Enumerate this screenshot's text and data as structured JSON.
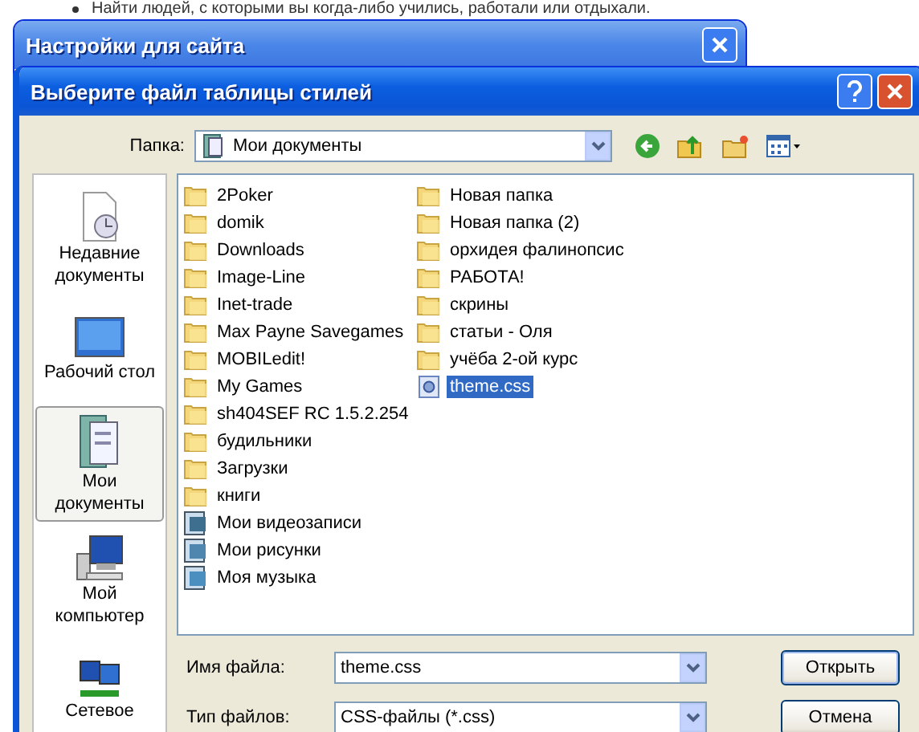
{
  "background_page": {
    "text": "Найти людей, с которыми вы когда-либо учились, работали или отдыхали."
  },
  "back_window": {
    "title": "Настройки для сайта"
  },
  "window": {
    "title": "Выберите файл таблицы стилей"
  },
  "folder_bar": {
    "label": "Папка:",
    "value": "Мои документы"
  },
  "places": [
    {
      "label": "Недавние документы",
      "kind": "recent",
      "selected": false
    },
    {
      "label": "Рабочий стол",
      "kind": "desktop",
      "selected": false
    },
    {
      "label": "Мои документы",
      "kind": "documents",
      "selected": true
    },
    {
      "label": "Мой компьютер",
      "kind": "computer",
      "selected": false
    },
    {
      "label": "Сетевое",
      "kind": "network",
      "selected": false
    }
  ],
  "files": [
    [
      {
        "name": "2Poker",
        "kind": "folder",
        "selected": false
      },
      {
        "name": "domik",
        "kind": "folder",
        "selected": false
      },
      {
        "name": "Downloads",
        "kind": "folder",
        "selected": false
      },
      {
        "name": "Image-Line",
        "kind": "folder",
        "selected": false
      },
      {
        "name": "Inet-trade",
        "kind": "folder",
        "selected": false
      },
      {
        "name": "Max Payne Savegames",
        "kind": "folder",
        "selected": false
      },
      {
        "name": "MOBILedit!",
        "kind": "folder",
        "selected": false
      },
      {
        "name": "My Games",
        "kind": "folder",
        "selected": false
      },
      {
        "name": "sh404SEF RC 1.5.2.254",
        "kind": "folder",
        "selected": false
      },
      {
        "name": "будильники",
        "kind": "folder",
        "selected": false
      },
      {
        "name": "Загрузки",
        "kind": "folder",
        "selected": false
      },
      {
        "name": "книги",
        "kind": "folder",
        "selected": false
      },
      {
        "name": "Мои видеозаписи",
        "kind": "video",
        "selected": false
      },
      {
        "name": "Мои рисунки",
        "kind": "pictures",
        "selected": false
      },
      {
        "name": "Моя музыка",
        "kind": "music",
        "selected": false
      }
    ],
    [
      {
        "name": "Новая папка",
        "kind": "folder",
        "selected": false
      },
      {
        "name": "Новая папка (2)",
        "kind": "folder",
        "selected": false
      },
      {
        "name": "орхидея фалинопсис",
        "kind": "folder",
        "selected": false
      },
      {
        "name": "РАБОТА!",
        "kind": "folder",
        "selected": false
      },
      {
        "name": "скрины",
        "kind": "folder",
        "selected": false
      },
      {
        "name": "статьи - Оля",
        "kind": "folder",
        "selected": false
      },
      {
        "name": "учёба 2-ой курс",
        "kind": "folder",
        "selected": false
      },
      {
        "name": "theme.css",
        "kind": "css",
        "selected": true
      }
    ]
  ],
  "fields": [
    {
      "label": "Имя файла:",
      "value": "theme.css"
    },
    {
      "label": "Тип файлов:",
      "value": "CSS-файлы (*.css)"
    }
  ],
  "buttons": [
    "Открыть",
    "Отмена"
  ]
}
